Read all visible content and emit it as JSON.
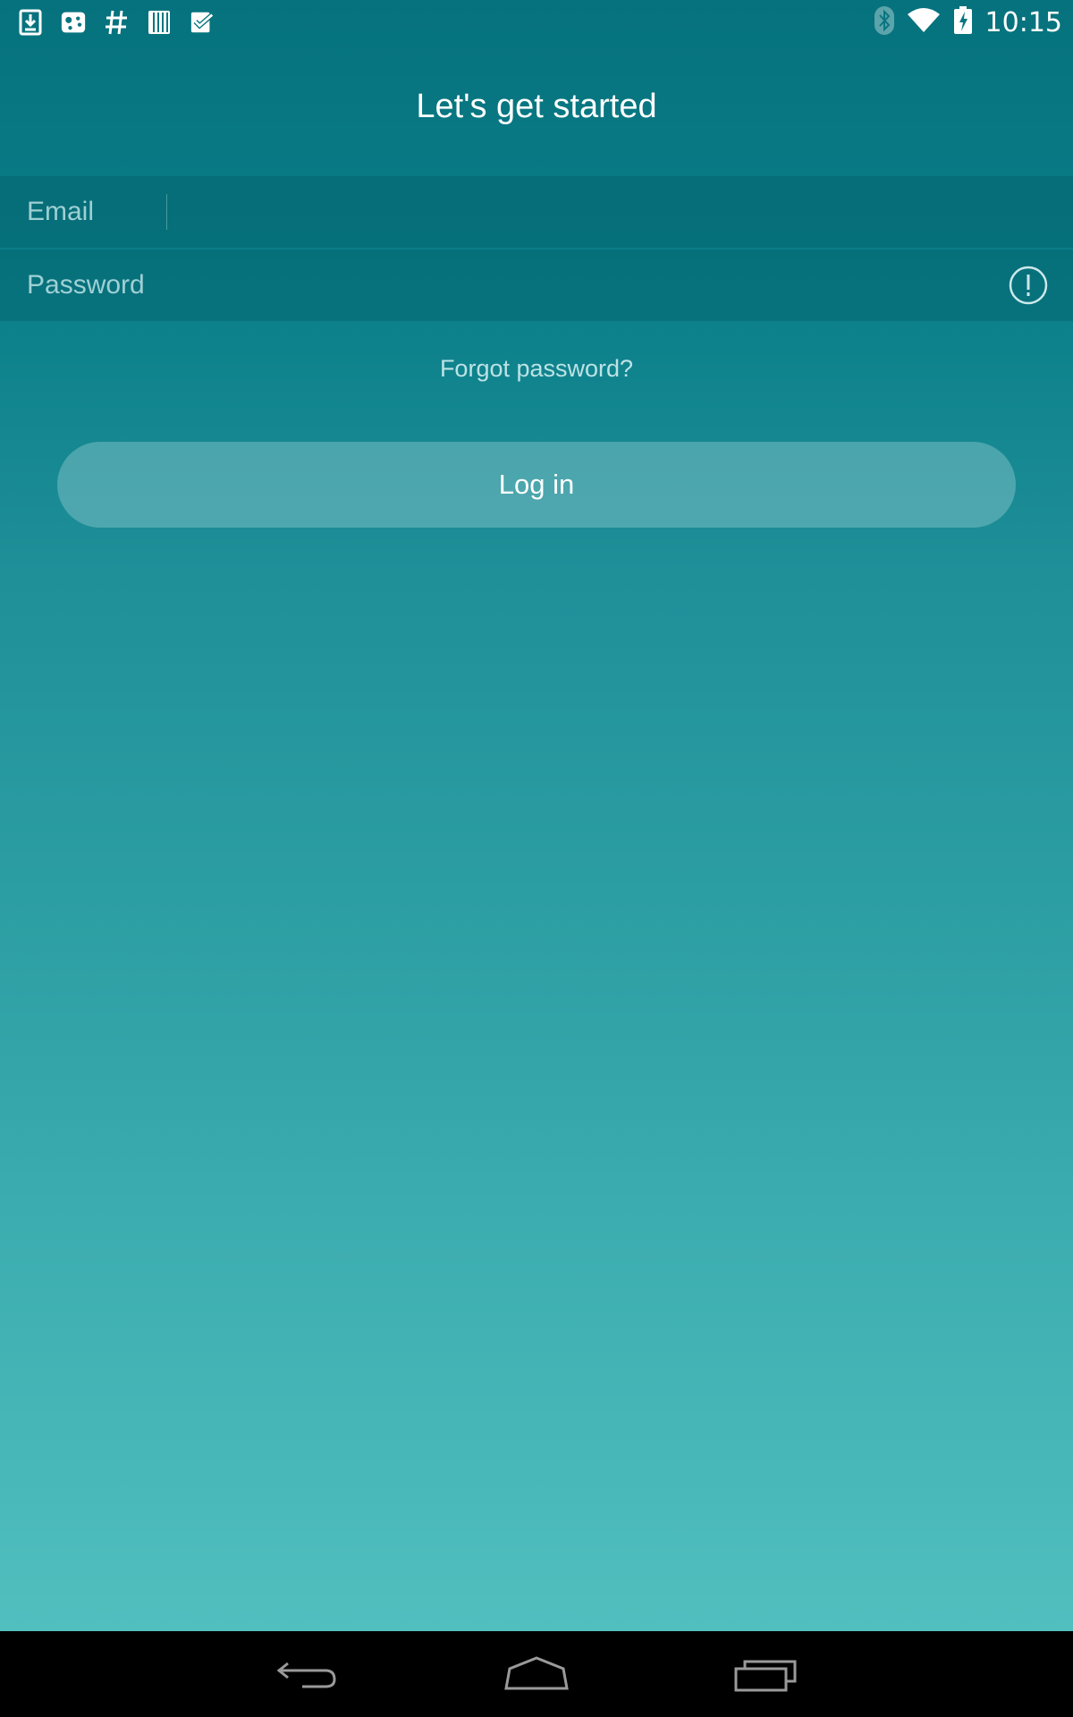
{
  "status_bar": {
    "time": "10:15",
    "left_icons": [
      "download-icon",
      "gamepad-icon",
      "hashtag-icon",
      "barcode-icon",
      "checklist-icon"
    ],
    "right_icons": [
      "bluetooth-icon",
      "wifi-icon",
      "battery-charging-icon"
    ]
  },
  "header": {
    "title": "Let's get started"
  },
  "form": {
    "email_label": "Email",
    "email_value": "",
    "password_label": "Password",
    "password_value": "",
    "forgot_password": "Forgot password?",
    "login_button": "Log in"
  },
  "nav_bar": {
    "buttons": [
      "back-icon",
      "home-icon",
      "recent-apps-icon"
    ]
  },
  "colors": {
    "gradient_top": "#06727d",
    "gradient_bottom": "#51bfbe",
    "text": "#ffffff"
  }
}
